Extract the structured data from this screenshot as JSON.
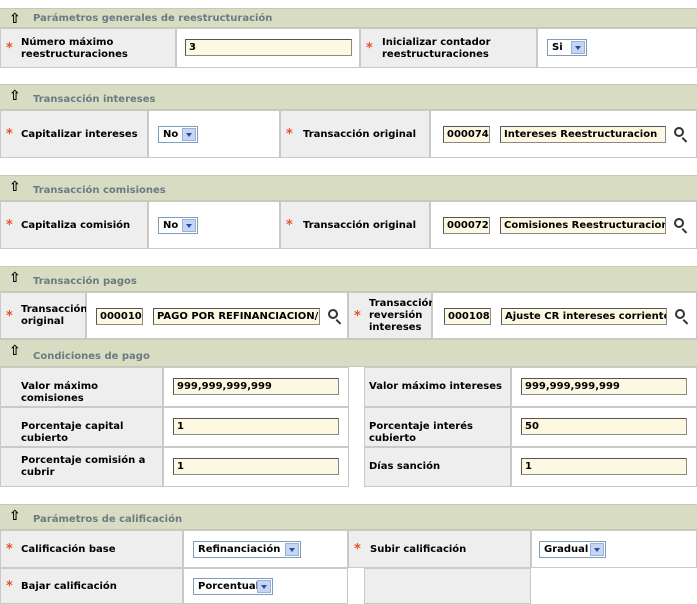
{
  "s1": {
    "title": "Parámetros generales de reestructuración",
    "num_max_label": "Número máximo reestructuraciones",
    "num_max_value": "3",
    "init_label": "Inicializar contador reestructuraciones",
    "init_value": "Si"
  },
  "s2": {
    "title": "Transacción intereses",
    "cap_label": "Capitalizar intereses",
    "cap_value": "No",
    "orig_label": "Transacción original",
    "orig_code": "000074",
    "orig_desc": "Intereses Reestructuracion"
  },
  "s3": {
    "title": "Transacción comisiones",
    "cap_label": "Capitaliza comisión",
    "cap_value": "No",
    "orig_label": "Transacción original",
    "orig_code": "000072",
    "orig_desc": "Comisiones Reestructuracion"
  },
  "s4": {
    "title": "Transacción pagos",
    "orig_label": "Transacción original",
    "orig_code": "000010",
    "orig_desc": "PAGO POR REFINANCIACION/R",
    "rev_label": "Transacción reversión intereses",
    "rev_code": "000108",
    "rev_desc": "Ajuste CR intereses corrientes"
  },
  "s5": {
    "title": "Condiciones de pago",
    "vmc_label": "Valor máximo comisiones",
    "vmc_value": "999,999,999,999",
    "vmi_label": "Valor máximo intereses",
    "vmi_value": "999,999,999,999",
    "pcc_label": "Porcentaje capital cubierto",
    "pcc_value": "1",
    "pic_label": "Porcentaje interés cubierto",
    "pic_value": "50",
    "pca_label": "Porcentaje comisión a cubrir",
    "pca_value": "1",
    "ds_label": "Días sanción",
    "ds_value": "1"
  },
  "s6": {
    "title": "Parámetros de calificación",
    "cb_label": "Calificación base",
    "cb_value": "Refinanciación",
    "sub_label": "Subir calificación",
    "sub_value": "Gradual",
    "baj_label": "Bajar calificación",
    "baj_value": "Porcentual"
  },
  "required_mark": "*",
  "collapse_icon": "up-arrow-icon",
  "lookup_icon": "magnifier-icon",
  "colors": {
    "header_bg": "#d7dcc3",
    "header_text": "#6b7b80",
    "required": "#e2542b",
    "input_bg": "#fdf8e1"
  }
}
